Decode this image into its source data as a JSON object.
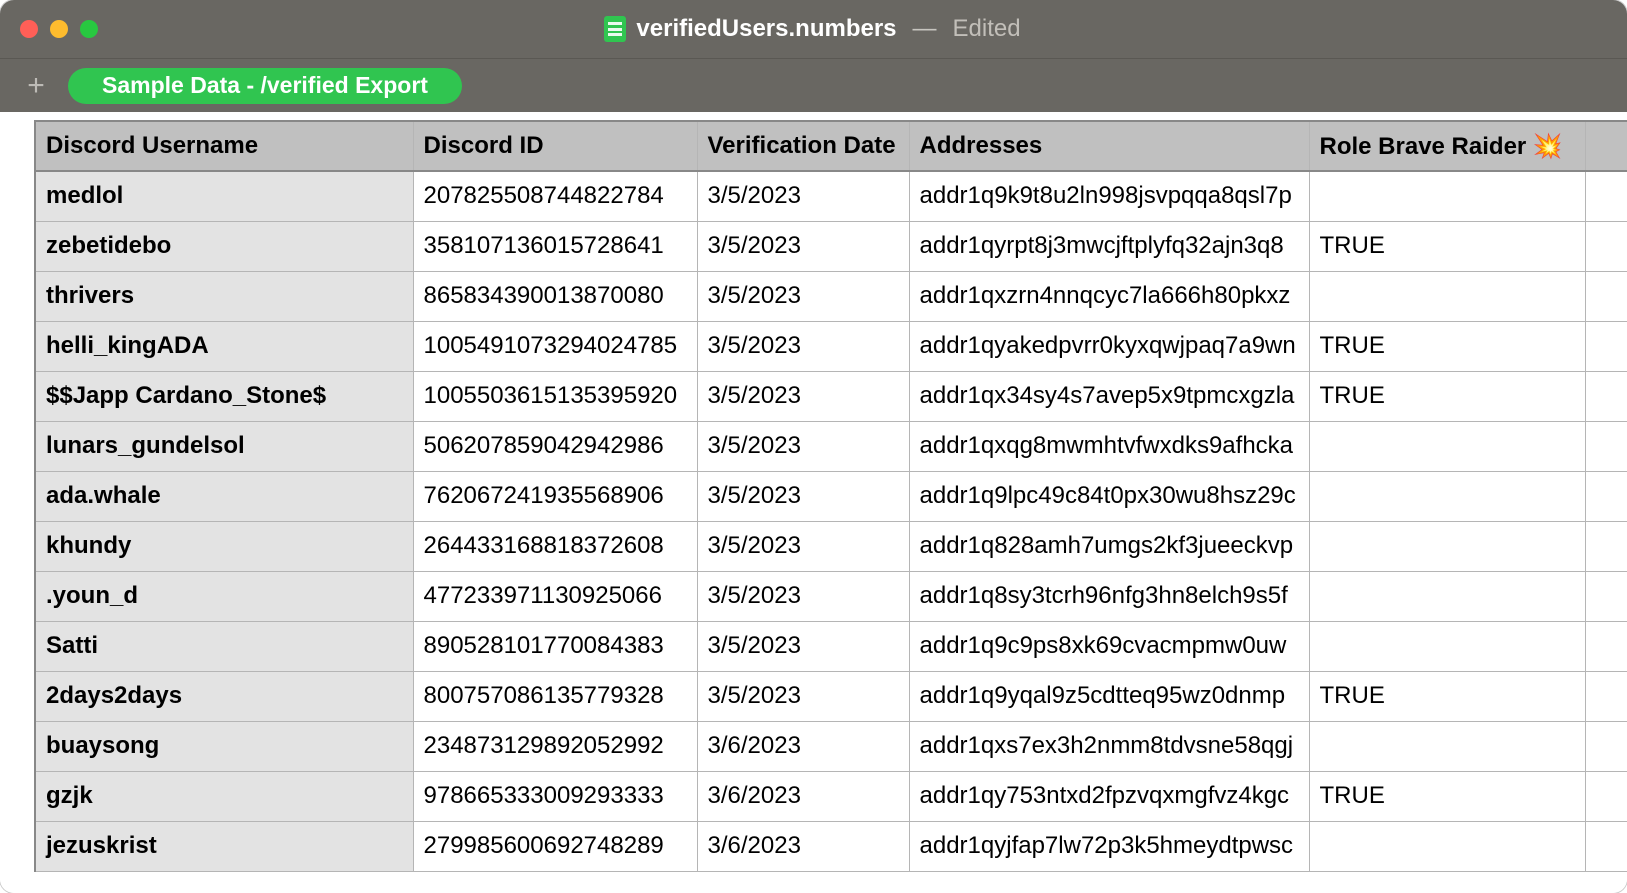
{
  "window": {
    "filename": "verifiedUsers.numbers",
    "separator": "—",
    "status": "Edited"
  },
  "tabbar": {
    "active_sheet": "Sample Data - /verified Export"
  },
  "table": {
    "headers": {
      "c1": "Discord Username",
      "c2": "Discord ID",
      "c3": "Verification Date",
      "c4": "Addresses",
      "c5": "Role Brave Raider 💥"
    },
    "rows": [
      {
        "username": "medlol",
        "id": "207825508744822784",
        "date": "3/5/2023",
        "addr": "addr1q9k9t8u2ln998jsvpqqa8qsl7p",
        "role": ""
      },
      {
        "username": "zebetidebo",
        "id": "358107136015728641",
        "date": "3/5/2023",
        "addr": "addr1qyrpt8j3mwcjftplyfq32ajn3q8",
        "role": "TRUE"
      },
      {
        "username": "thrivers",
        "id": "865834390013870080",
        "date": "3/5/2023",
        "addr": "addr1qxzrn4nnqcyc7la666h80pkxz",
        "role": ""
      },
      {
        "username": "helli_kingADA",
        "id": "1005491073294024785",
        "date": "3/5/2023",
        "addr": "addr1qyakedpvrr0kyxqwjpaq7a9wn",
        "role": "TRUE"
      },
      {
        "username": "$$Japp Cardano_Stone$",
        "id": "1005503615135395920",
        "date": "3/5/2023",
        "addr": "addr1qx34sy4s7avep5x9tpmcxgzla",
        "role": "TRUE"
      },
      {
        "username": "lunars_gundelsol",
        "id": "506207859042942986",
        "date": "3/5/2023",
        "addr": "addr1qxqg8mwmhtvfwxdks9afhcka",
        "role": ""
      },
      {
        "username": "ada.whale",
        "id": "762067241935568906",
        "date": "3/5/2023",
        "addr": "addr1q9lpc49c84t0px30wu8hsz29c",
        "role": ""
      },
      {
        "username": "khundy",
        "id": "264433168818372608",
        "date": "3/5/2023",
        "addr": "addr1q828amh7umgs2kf3jueeckvp",
        "role": ""
      },
      {
        "username": ".youn_d",
        "id": "477233971130925066",
        "date": "3/5/2023",
        "addr": "addr1q8sy3tcrh96nfg3hn8elch9s5f",
        "role": ""
      },
      {
        "username": "Satti",
        "id": "890528101770084383",
        "date": "3/5/2023",
        "addr": "addr1q9c9ps8xk69cvacmpmw0uw",
        "role": ""
      },
      {
        "username": "2days2days",
        "id": "800757086135779328",
        "date": "3/5/2023",
        "addr": "addr1q9yqal9z5cdtteq95wz0dnmp",
        "role": "TRUE"
      },
      {
        "username": "buaysong",
        "id": "234873129892052992",
        "date": "3/6/2023",
        "addr": "addr1qxs7ex3h2nmm8tdvsne58qgj",
        "role": ""
      },
      {
        "username": "gzjk",
        "id": "978665333009293333",
        "date": "3/6/2023",
        "addr": "addr1qy753ntxd2fpzvqxmgfvz4kgc",
        "role": "TRUE"
      },
      {
        "username": "jezuskrist",
        "id": "279985600692748289",
        "date": "3/6/2023",
        "addr": "addr1qyjfap7lw72p3k5hmeydtpwsc",
        "role": ""
      }
    ]
  }
}
